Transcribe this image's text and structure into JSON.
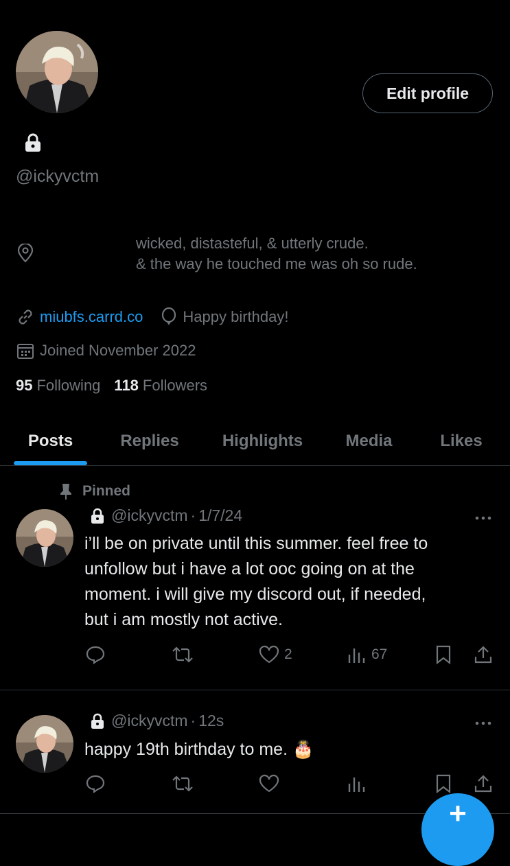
{
  "profile": {
    "handle": "@ickyvctm",
    "edit_label": "Edit profile",
    "bio_line1": "wicked, distasteful, & utterly crude.",
    "bio_line2": "& the way he touched me was oh so rude.",
    "link": "miubfs.carrd.co",
    "birthday": "Happy birthday!",
    "joined": "Joined November 2022",
    "following_count": "95",
    "following_label": "Following",
    "followers_count": "118",
    "followers_label": "Followers",
    "icons": [
      "lock-icon",
      "location-icon",
      "link-icon",
      "balloon-icon",
      "calendar-icon"
    ]
  },
  "tabs": [
    "Posts",
    "Replies",
    "Highlights",
    "Media",
    "Likes"
  ],
  "active_tab": "Posts",
  "posts": [
    {
      "pinned_label": "Pinned",
      "handle": "@ickyvctm",
      "separator": "·",
      "time": "1/7/24",
      "line1": "i’ll be on private until this summer. feel free to",
      "line2": "unfollow but i have a lot ooc going on at the",
      "line3": "moment. i will give my discord out, if needed,",
      "line4": "but i am mostly not active.",
      "likes": "2",
      "views": "67"
    },
    {
      "handle": "@ickyvctm",
      "separator": "·",
      "time": "12s",
      "text": "happy 19th birthday to me. 🎂"
    }
  ],
  "fab_label": "+",
  "colors": {
    "accent": "#1d9bf0",
    "muted": "#71767b",
    "text": "#e7e9ea",
    "border": "#2f3336",
    "background": "#000000"
  }
}
